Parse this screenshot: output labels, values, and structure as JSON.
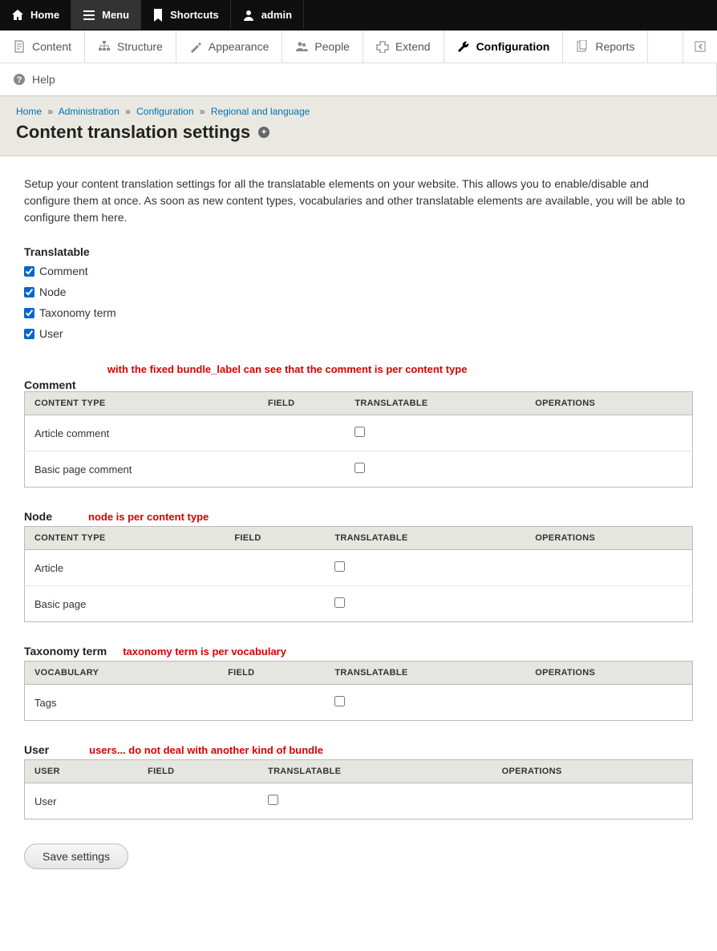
{
  "toolbar": {
    "home": "Home",
    "menu": "Menu",
    "shortcuts": "Shortcuts",
    "admin": "admin"
  },
  "admin_tabs": {
    "content": "Content",
    "structure": "Structure",
    "appearance": "Appearance",
    "people": "People",
    "extend": "Extend",
    "configuration": "Configuration",
    "reports": "Reports",
    "help": "Help"
  },
  "breadcrumb": {
    "home": "Home",
    "administration": "Administration",
    "configuration": "Configuration",
    "regional": "Regional and language"
  },
  "page_title": "Content translation settings",
  "intro": "Setup your content translation settings for all the translatable elements on your website. This allows you to enable/disable and configure them at once. As soon as new content types, vocabularies and other translatable elements are available, you will be able to configure them here.",
  "translatable_heading": "Translatable",
  "translatable_items": {
    "comment": "Comment",
    "node": "Node",
    "taxonomy_term": "Taxonomy term",
    "user": "User"
  },
  "annotations": {
    "comment": "with the fixed bundle_label can see that the comment is per content type",
    "node": "node is per content type",
    "taxonomy": "taxonomy term is per vocabulary",
    "user": "users... do not deal with another kind of bundle"
  },
  "tables": {
    "comment": {
      "heading": "Comment",
      "columns": [
        "CONTENT TYPE",
        "FIELD",
        "TRANSLATABLE",
        "OPERATIONS"
      ],
      "rows": [
        "Article comment",
        "Basic page comment"
      ]
    },
    "node": {
      "heading": "Node",
      "columns": [
        "CONTENT TYPE",
        "FIELD",
        "TRANSLATABLE",
        "OPERATIONS"
      ],
      "rows": [
        "Article",
        "Basic page"
      ]
    },
    "taxonomy": {
      "heading": "Taxonomy term",
      "columns": [
        "VOCABULARY",
        "FIELD",
        "TRANSLATABLE",
        "OPERATIONS"
      ],
      "rows": [
        "Tags"
      ]
    },
    "user": {
      "heading": "User",
      "columns": [
        "USER",
        "FIELD",
        "TRANSLATABLE",
        "OPERATIONS"
      ],
      "rows": [
        "User"
      ]
    }
  },
  "save_label": "Save settings"
}
